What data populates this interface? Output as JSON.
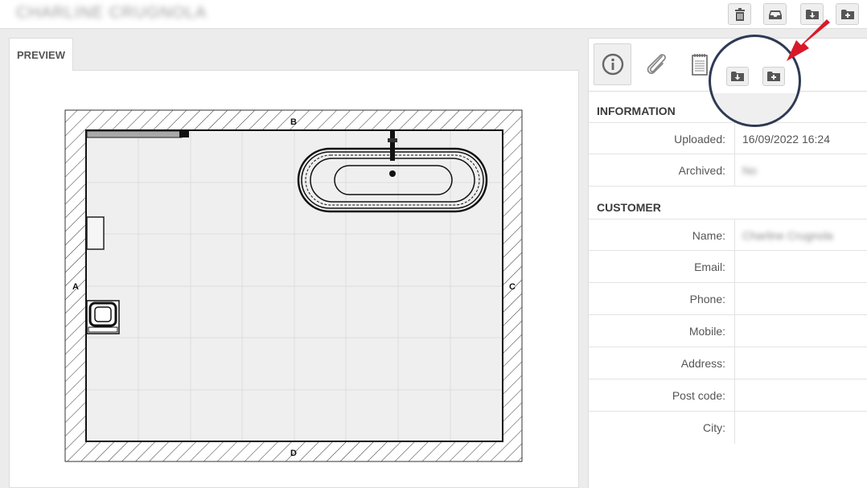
{
  "header": {
    "title": "CHARLINE CRUGNOLA",
    "buttons": [
      {
        "name": "delete-button",
        "icon": "trash-icon"
      },
      {
        "name": "archive-button",
        "icon": "inbox-icon"
      },
      {
        "name": "download-folder-button",
        "icon": "folder-download-icon"
      },
      {
        "name": "add-folder-button",
        "icon": "folder-add-icon"
      }
    ]
  },
  "preview": {
    "tab_label": "PREVIEW",
    "wall_labels": {
      "top": "B",
      "left": "A",
      "right": "C",
      "bottom": "D"
    }
  },
  "side_tabs": [
    {
      "name": "tab-information",
      "icon": "info-icon",
      "active": true
    },
    {
      "name": "tab-attachments",
      "icon": "paperclip-icon",
      "active": false
    },
    {
      "name": "tab-notes",
      "icon": "notepad-icon",
      "active": false
    }
  ],
  "information": {
    "heading": "INFORMATION",
    "uploaded_label": "Uploaded:",
    "uploaded_value": "16/09/2022 16:24",
    "archived_label": "Archived:",
    "archived_value": "No"
  },
  "customer": {
    "heading": "CUSTOMER",
    "name_label": "Name:",
    "name_value": "Charline Crugnola",
    "email_label": "Email:",
    "phone_label": "Phone:",
    "mobile_label": "Mobile:",
    "address_label": "Address:",
    "postcode_label": "Post code:",
    "city_label": "City:"
  },
  "colors": {
    "magnifier_ring": "#2e3a55",
    "arrow": "#d9192a"
  }
}
